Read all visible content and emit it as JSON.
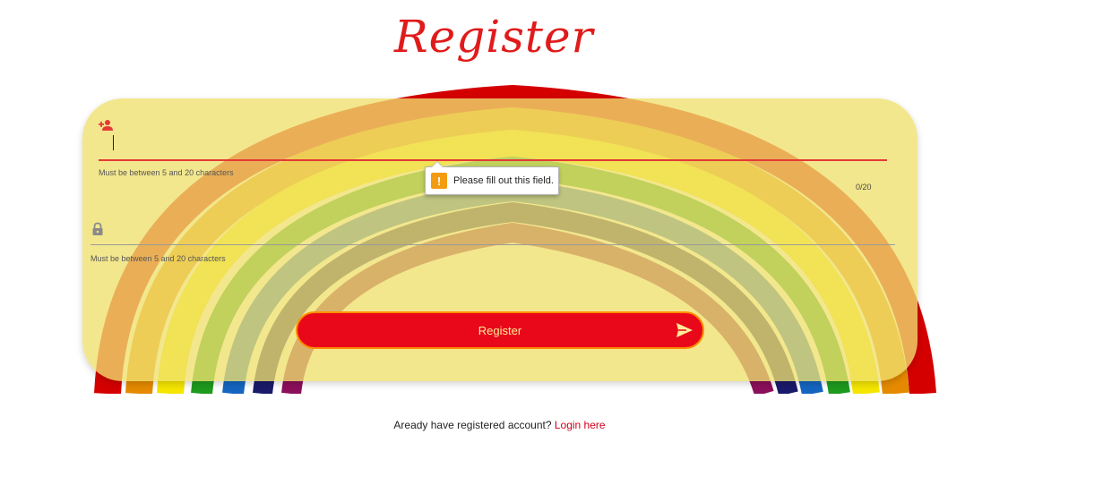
{
  "header": {
    "title": "Register"
  },
  "form": {
    "username": {
      "value": "",
      "hint": "Must be between 5 and 20 characters",
      "counter": "0/20",
      "icon": "add-user-icon"
    },
    "password": {
      "value": "",
      "hint": "Must be between 5 and 20 characters",
      "icon": "lock-icon"
    },
    "validation": {
      "message": "Please fill out this field.",
      "icon": "warning-icon"
    },
    "submit": {
      "label": "Register",
      "icon": "send-icon"
    }
  },
  "footer": {
    "text": "Aready have registered account?",
    "link": "Login here"
  },
  "colors": {
    "accent": "#e8081a",
    "title": "#e01b1b",
    "card": "#f0e06e",
    "link": "#d0021b",
    "button_border": "#ff8c00"
  }
}
